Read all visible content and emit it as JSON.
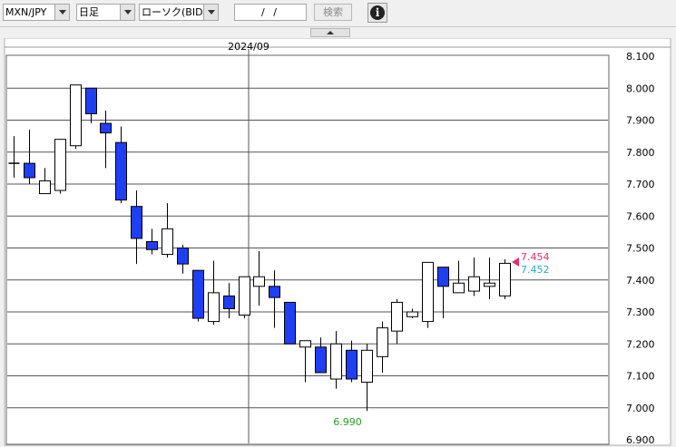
{
  "toolbar": {
    "symbol": "MXN/JPY",
    "timeframe": "日足",
    "chart_kind": "ローソク(BID)",
    "date_value": "/ /",
    "search_label": "検索",
    "info_icon": "info-icon",
    "info_glyph": "i"
  },
  "colors": {
    "bull": "#ffffff",
    "bear": "#1f3ff5",
    "ask": "#e0306a",
    "bid": "#27a6d6",
    "low_label": "#21a121"
  },
  "chart_data": {
    "type": "candlestick",
    "date_label": "2024/09",
    "ylim": [
      6.9,
      8.1
    ],
    "y_ticks": [
      "8.100",
      "8.000",
      "7.900",
      "7.800",
      "7.700",
      "7.600",
      "7.500",
      "7.400",
      "7.300",
      "7.200",
      "7.100",
      "7.000",
      "6.900"
    ],
    "candles": [
      {
        "o": 7.765,
        "h": 7.85,
        "l": 7.72,
        "c": 7.765
      },
      {
        "o": 7.765,
        "h": 7.87,
        "l": 7.7,
        "c": 7.72
      },
      {
        "o": 7.67,
        "h": 7.75,
        "l": 7.67,
        "c": 7.71
      },
      {
        "o": 7.68,
        "h": 7.84,
        "l": 7.67,
        "c": 7.84
      },
      {
        "o": 7.82,
        "h": 8.01,
        "l": 7.81,
        "c": 8.01
      },
      {
        "o": 8.0,
        "h": 8.0,
        "l": 7.89,
        "c": 7.92
      },
      {
        "o": 7.89,
        "h": 7.93,
        "l": 7.75,
        "c": 7.86
      },
      {
        "o": 7.83,
        "h": 7.88,
        "l": 7.64,
        "c": 7.65
      },
      {
        "o": 7.63,
        "h": 7.68,
        "l": 7.45,
        "c": 7.53
      },
      {
        "o": 7.52,
        "h": 7.56,
        "l": 7.48,
        "c": 7.495
      },
      {
        "o": 7.48,
        "h": 7.64,
        "l": 7.47,
        "c": 7.56
      },
      {
        "o": 7.5,
        "h": 7.51,
        "l": 7.42,
        "c": 7.45
      },
      {
        "o": 7.43,
        "h": 7.43,
        "l": 7.27,
        "c": 7.28
      },
      {
        "o": 7.27,
        "h": 7.46,
        "l": 7.26,
        "c": 7.36
      },
      {
        "o": 7.35,
        "h": 7.39,
        "l": 7.28,
        "c": 7.31
      },
      {
        "o": 7.29,
        "h": 7.41,
        "l": 7.28,
        "c": 7.41
      },
      {
        "o": 7.38,
        "h": 7.49,
        "l": 7.32,
        "c": 7.41
      },
      {
        "o": 7.38,
        "h": 7.43,
        "l": 7.25,
        "c": 7.345
      },
      {
        "o": 7.33,
        "h": 7.33,
        "l": 7.2,
        "c": 7.2
      },
      {
        "o": 7.19,
        "h": 7.21,
        "l": 7.08,
        "c": 7.21
      },
      {
        "o": 7.19,
        "h": 7.22,
        "l": 7.11,
        "c": 7.11
      },
      {
        "o": 7.09,
        "h": 7.24,
        "l": 7.06,
        "c": 7.2
      },
      {
        "o": 7.18,
        "h": 7.21,
        "l": 7.08,
        "c": 7.09
      },
      {
        "o": 7.08,
        "h": 7.2,
        "l": 6.99,
        "c": 7.18
      },
      {
        "o": 7.16,
        "h": 7.27,
        "l": 7.11,
        "c": 7.25
      },
      {
        "o": 7.24,
        "h": 7.34,
        "l": 7.2,
        "c": 7.33
      },
      {
        "o": 7.285,
        "h": 7.31,
        "l": 7.28,
        "c": 7.3
      },
      {
        "o": 7.27,
        "h": 7.455,
        "l": 7.25,
        "c": 7.455
      },
      {
        "o": 7.44,
        "h": 7.44,
        "l": 7.28,
        "c": 7.38
      },
      {
        "o": 7.36,
        "h": 7.46,
        "l": 7.36,
        "c": 7.39
      },
      {
        "o": 7.365,
        "h": 7.47,
        "l": 7.35,
        "c": 7.41
      },
      {
        "o": 7.38,
        "h": 7.47,
        "l": 7.34,
        "c": 7.39
      },
      {
        "o": 7.35,
        "h": 7.465,
        "l": 7.34,
        "c": 7.452
      }
    ],
    "low_annotation": "6.990",
    "ask_label": "7.454",
    "bid_label": "7.452"
  }
}
